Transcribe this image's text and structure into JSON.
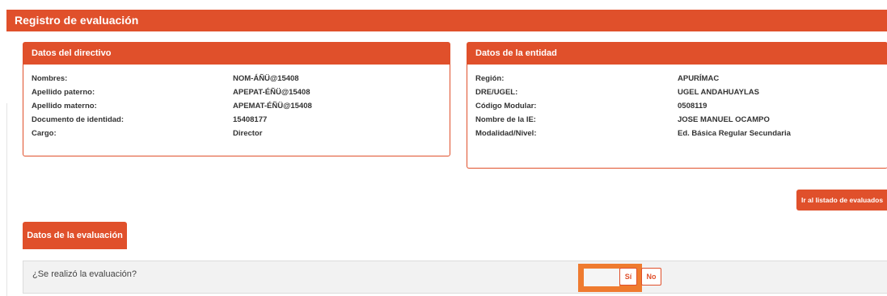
{
  "header": {
    "title": "Registro de evaluación"
  },
  "directivo": {
    "title": "Datos del directivo",
    "rows": [
      {
        "label": "Nombres:",
        "value": "NOM-ÁÑÜ@15408"
      },
      {
        "label": "Apellido paterno:",
        "value": "APEPAT-ÉÑÜ@15408"
      },
      {
        "label": "Apellido materno:",
        "value": "APEMAT-ÉÑÜ@15408"
      },
      {
        "label": "Documento de identidad:",
        "value": "15408177"
      },
      {
        "label": "Cargo:",
        "value": "Director"
      }
    ]
  },
  "entidad": {
    "title": "Datos de la entidad",
    "rows": [
      {
        "label": "Región:",
        "value": "APURÍMAC"
      },
      {
        "label": "DRE/UGEL:",
        "value": "UGEL ANDAHUAYLAS"
      },
      {
        "label": "Código Modular:",
        "value": "0508119"
      },
      {
        "label": "Nombre de la IE:",
        "value": "JOSE MANUEL OCAMPO"
      },
      {
        "label": "Modalidad/Nivel:",
        "value": "Ed. Básica Regular Secundaria"
      }
    ]
  },
  "actions": {
    "listado_label": "Ir al listado de evaluados"
  },
  "evaluacion": {
    "tab_label": "Datos de la evaluación",
    "question": "¿Se realizó la evaluación?",
    "yes_label": "Sí",
    "no_label": "No"
  },
  "colors": {
    "accent": "#e0502b",
    "highlight": "#ef7b2f"
  }
}
